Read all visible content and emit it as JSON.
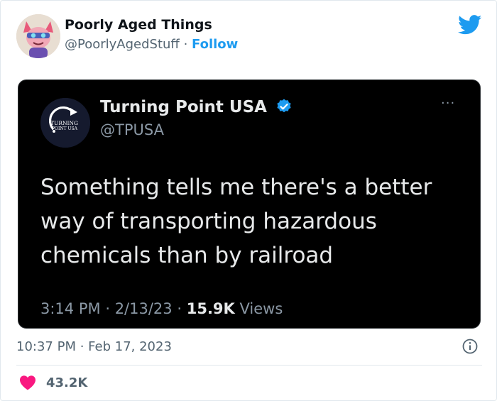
{
  "author": {
    "name": "Poorly Aged Things",
    "handle": "@PoorlyAgedStuff",
    "separator": "·",
    "follow_label": "Follow",
    "avatar_icon": "cartoon-avatar"
  },
  "embedded_tweet": {
    "author_name": "Turning Point USA",
    "author_handle": "@TPUSA",
    "logo_text_line1": "TURNING",
    "logo_text_line2": "POINT USA",
    "more_label": "···",
    "text": "Something tells me there's a better way of transporting hazardous chemicals than by railroad",
    "time": "3:14 PM",
    "date": "2/13/23",
    "views_count": "15.9K",
    "views_label": "Views",
    "separator": "·"
  },
  "timestamp": "10:37 PM · Feb 17, 2023",
  "likes": {
    "count": "43.2K",
    "icon": "heart-icon"
  },
  "colors": {
    "twitter_blue": "#1d9bf0",
    "like_red": "#f91880",
    "verified_blue": "#1d9bf0",
    "dark_bg": "#000000"
  }
}
